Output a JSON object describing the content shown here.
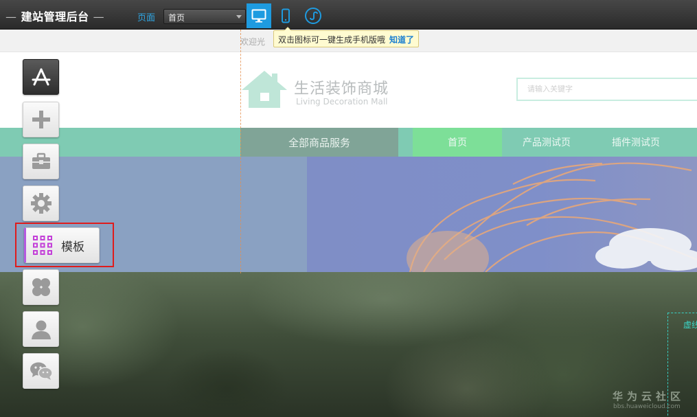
{
  "topbar": {
    "title": "建站管理后台",
    "title_dash": "—",
    "page_label": "页面",
    "page_select_value": "首页",
    "devices": [
      "desktop-icon",
      "mobile-icon",
      "mini-program-icon"
    ],
    "active_device": "desktop",
    "accent_color": "#1e9be0"
  },
  "tooltip": {
    "text": "双击图标可一键生成手机版哦",
    "ok_label": "知道了"
  },
  "site": {
    "welcome_text": "欢迎光",
    "logo_cn": "生活装饰商城",
    "logo_en": "Living Decoration Mall",
    "search_placeholder": "请输入关键字",
    "nav": {
      "all_label": "全部商品服务",
      "items": [
        "首页",
        "产品测试页",
        "插件测试页"
      ]
    },
    "virtual_box_label": "虚线",
    "brand_color": "#7fcbb3"
  },
  "tools": [
    {
      "icon": "app-store-icon"
    },
    {
      "icon": "plus-icon"
    },
    {
      "icon": "toolbox-icon"
    },
    {
      "icon": "gear-icon"
    },
    {
      "icon": "grid-icon",
      "label": "模板"
    },
    {
      "icon": "clover-icon"
    },
    {
      "icon": "user-icon"
    },
    {
      "icon": "wechat-icon"
    }
  ],
  "watermark": {
    "name": "华为云社区",
    "url": "bbs.huaweicloud.com"
  }
}
